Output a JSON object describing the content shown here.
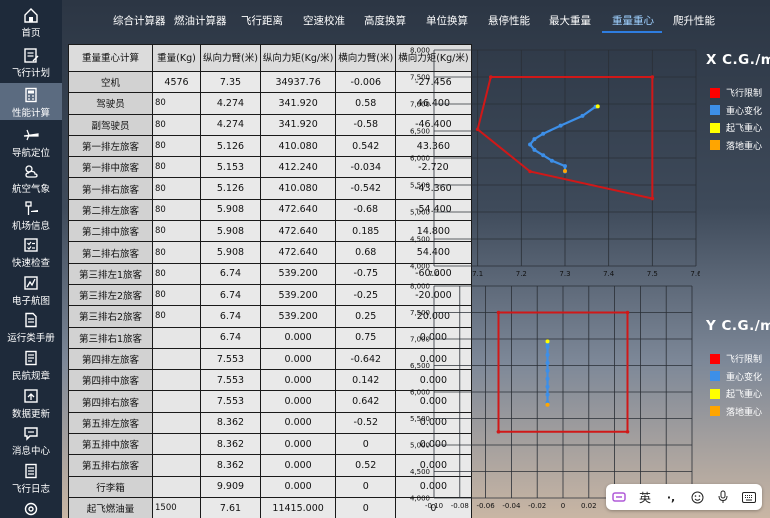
{
  "sidebar": {
    "items": [
      {
        "label": "首页",
        "icon": "home-icon"
      },
      {
        "label": "飞行计划",
        "icon": "flight-plan-icon"
      },
      {
        "label": "性能计算",
        "icon": "calculator-icon",
        "active": true
      },
      {
        "label": "导航定位",
        "icon": "airplane-icon"
      },
      {
        "label": "航空气象",
        "icon": "weather-icon"
      },
      {
        "label": "机场信息",
        "icon": "airport-icon"
      },
      {
        "label": "快速检查",
        "icon": "checklist-icon"
      },
      {
        "label": "电子航图",
        "icon": "chart-map-icon"
      },
      {
        "label": "运行类手册",
        "icon": "manual-icon"
      },
      {
        "label": "民航规章",
        "icon": "regulation-icon"
      },
      {
        "label": "数据更新",
        "icon": "update-icon"
      },
      {
        "label": "消息中心",
        "icon": "message-icon"
      },
      {
        "label": "飞行日志",
        "icon": "logbook-icon"
      },
      {
        "label": "",
        "icon": "settings-icon"
      }
    ]
  },
  "tabs": [
    {
      "label": "综合计算器"
    },
    {
      "label": "燃油计算器"
    },
    {
      "label": "飞行距离"
    },
    {
      "label": "空速校准"
    },
    {
      "label": "高度换算"
    },
    {
      "label": "单位换算"
    },
    {
      "label": "悬停性能"
    },
    {
      "label": "最大重量"
    },
    {
      "label": "重量重心",
      "active": true
    },
    {
      "label": "爬升性能"
    }
  ],
  "table": {
    "headers": [
      "重量重心计算",
      "重量(Kg)",
      "纵向力臂(米)",
      "纵向力矩(Kg/米)",
      "横向力臂(米)",
      "横向力矩(Kg/米)"
    ],
    "rows": [
      {
        "name": "空机",
        "mass": "4576",
        "arm": "7.35",
        "moment": "34937.76",
        "larm": "-0.006",
        "lmoment": "-27.456"
      },
      {
        "name": "驾驶员",
        "mass": "80",
        "arm": "4.274",
        "moment": "341.920",
        "larm": "0.58",
        "lmoment": "46.400"
      },
      {
        "name": "副驾驶员",
        "mass": "80",
        "arm": "4.274",
        "moment": "341.920",
        "larm": "-0.58",
        "lmoment": "-46.400"
      },
      {
        "name": "第一排左旅客",
        "mass": "80",
        "arm": "5.126",
        "moment": "410.080",
        "larm": "0.542",
        "lmoment": "43.360"
      },
      {
        "name": "第一排中旅客",
        "mass": "80",
        "arm": "5.153",
        "moment": "412.240",
        "larm": "-0.034",
        "lmoment": "-2.720"
      },
      {
        "name": "第一排右旅客",
        "mass": "80",
        "arm": "5.126",
        "moment": "410.080",
        "larm": "-0.542",
        "lmoment": "-43.360"
      },
      {
        "name": "第二排左旅客",
        "mass": "80",
        "arm": "5.908",
        "moment": "472.640",
        "larm": "-0.68",
        "lmoment": "-54.400"
      },
      {
        "name": "第二排中旅客",
        "mass": "80",
        "arm": "5.908",
        "moment": "472.640",
        "larm": "0.185",
        "lmoment": "14.800"
      },
      {
        "name": "第二排右旅客",
        "mass": "80",
        "arm": "5.908",
        "moment": "472.640",
        "larm": "0.68",
        "lmoment": "54.400"
      },
      {
        "name": "第三排左1旅客",
        "mass": "80",
        "arm": "6.74",
        "moment": "539.200",
        "larm": "-0.75",
        "lmoment": "-60.000"
      },
      {
        "name": "第三排左2旅客",
        "mass": "80",
        "arm": "6.74",
        "moment": "539.200",
        "larm": "-0.25",
        "lmoment": "-20.000"
      },
      {
        "name": "第三排右2旅客",
        "mass": "80",
        "arm": "6.74",
        "moment": "539.200",
        "larm": "0.25",
        "lmoment": "20.000"
      },
      {
        "name": "第三排右1旅客",
        "mass": "",
        "arm": "6.74",
        "moment": "0.000",
        "larm": "0.75",
        "lmoment": "0.000"
      },
      {
        "name": "第四排左旅客",
        "mass": "",
        "arm": "7.553",
        "moment": "0.000",
        "larm": "-0.642",
        "lmoment": "0.000"
      },
      {
        "name": "第四排中旅客",
        "mass": "",
        "arm": "7.553",
        "moment": "0.000",
        "larm": "0.142",
        "lmoment": "0.000"
      },
      {
        "name": "第四排右旅客",
        "mass": "",
        "arm": "7.553",
        "moment": "0.000",
        "larm": "0.642",
        "lmoment": "0.000"
      },
      {
        "name": "第五排左旅客",
        "mass": "",
        "arm": "8.362",
        "moment": "0.000",
        "larm": "-0.52",
        "lmoment": "0.000"
      },
      {
        "name": "第五排中旅客",
        "mass": "",
        "arm": "8.362",
        "moment": "0.000",
        "larm": "0",
        "lmoment": "0.000"
      },
      {
        "name": "第五排右旅客",
        "mass": "",
        "arm": "8.362",
        "moment": "0.000",
        "larm": "0.52",
        "lmoment": "0.000"
      },
      {
        "name": "行李箱",
        "mass": "",
        "arm": "9.909",
        "moment": "0.000",
        "larm": "0",
        "lmoment": "0.000"
      },
      {
        "name": "起飞燃油量",
        "mass": "1500",
        "arm": "7.61",
        "moment": "11415.000",
        "larm": "0",
        "lmoment": "0"
      }
    ]
  },
  "legend": [
    {
      "label": "飞行限制",
      "color": "#ff0000"
    },
    {
      "label": "重心变化",
      "color": "#3d8fe8"
    },
    {
      "label": "起飞重心",
      "color": "#ffff00"
    },
    {
      "label": "落地重心",
      "color": "#ffa500"
    }
  ],
  "chart_data": [
    {
      "type": "line",
      "title": "X C.G./m",
      "xlim": [
        7.0,
        7.6
      ],
      "ylim": [
        4000,
        8000
      ],
      "x_ticks": [
        "7.0",
        "7.1",
        "7.2",
        "7.3",
        "7.4",
        "7.5",
        "7.6"
      ],
      "y_ticks": [
        "4,000",
        "4,500",
        "5,000",
        "5,500",
        "6,000",
        "6,500",
        "7,000",
        "7,500",
        "8,000"
      ],
      "series": [
        {
          "name": "飞行限制",
          "color": "#d01818",
          "x": [
            7.5,
            7.5,
            7.13,
            7.1,
            7.22,
            7.5
          ],
          "y": [
            5250,
            7500,
            7500,
            6530,
            5750,
            5250
          ]
        },
        {
          "name": "重心变化",
          "color": "#3d8fe8",
          "x": [
            7.3,
            7.3,
            7.27,
            7.25,
            7.23,
            7.22,
            7.23,
            7.25,
            7.29,
            7.34,
            7.37
          ],
          "y": [
            5750,
            5850,
            5950,
            6050,
            6150,
            6250,
            6350,
            6450,
            6600,
            6780,
            6950
          ]
        },
        {
          "name": "起飞重心",
          "color": "#ffff00",
          "x": [
            7.375
          ],
          "y": [
            6955
          ]
        },
        {
          "name": "落地重心",
          "color": "#ffa500",
          "x": [
            7.3
          ],
          "y": [
            5760
          ]
        }
      ]
    },
    {
      "type": "line",
      "title": "Y C.G./m",
      "xlim": [
        -0.1,
        0.1
      ],
      "ylim": [
        4000,
        8000
      ],
      "x_ticks": [
        "-0.10",
        "-0.08",
        "-0.06",
        "-0.04",
        "-0.02",
        "0",
        "0.02",
        "0.04",
        "0.06",
        "0.08",
        "0.10"
      ],
      "y_ticks": [
        "4,000",
        "4,500",
        "5,000",
        "5,500",
        "6,000",
        "6,500",
        "7,000",
        "7,500",
        "8,000"
      ],
      "series": [
        {
          "name": "飞行限制",
          "color": "#d01818",
          "x": [
            -0.05,
            0.05,
            0.05,
            -0.05,
            -0.05
          ],
          "y": [
            5250,
            5250,
            7500,
            7500,
            5250
          ]
        },
        {
          "name": "重心变化",
          "color": "#3d8fe8",
          "x": [
            -0.012,
            -0.012,
            -0.012,
            -0.012,
            -0.012,
            -0.012,
            -0.012,
            -0.012,
            -0.012,
            -0.012
          ],
          "y": [
            5800,
            5950,
            6100,
            6250,
            6400,
            6550,
            6700,
            6850,
            6950,
            6900
          ]
        },
        {
          "name": "起飞重心",
          "color": "#ffff00",
          "x": [
            -0.012
          ],
          "y": [
            6955
          ]
        },
        {
          "name": "落地重心",
          "color": "#ffa500",
          "x": [
            -0.012
          ],
          "y": [
            5760
          ]
        }
      ]
    }
  ],
  "ime": {
    "lang": "英",
    "punct": "·,"
  }
}
